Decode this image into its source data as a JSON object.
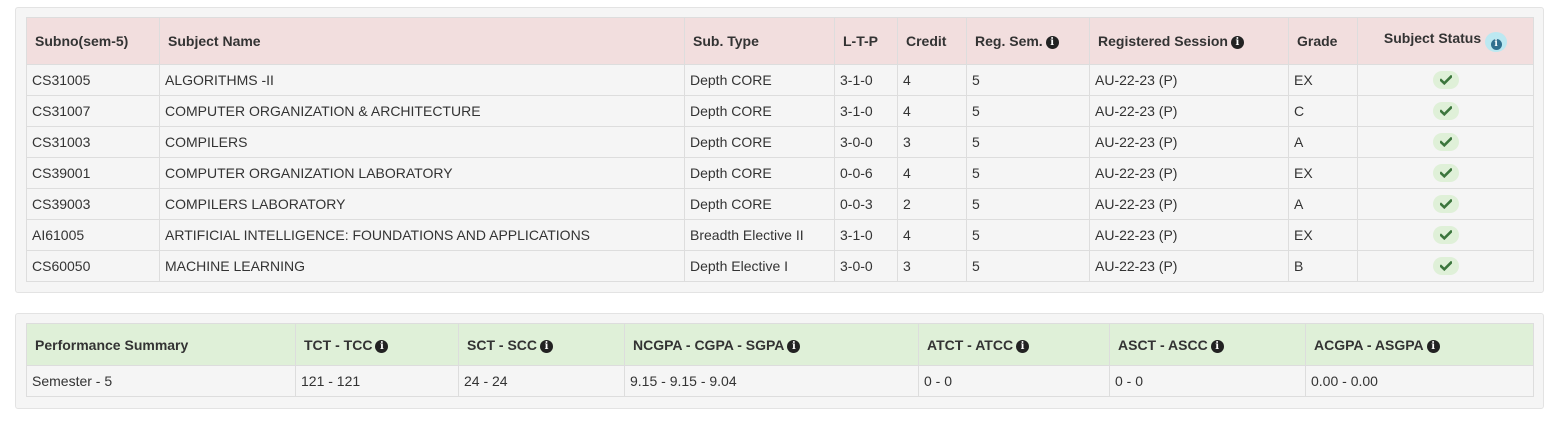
{
  "grades_table": {
    "headers": {
      "subno": "Subno(sem-5)",
      "subject_name": "Subject Name",
      "sub_type": "Sub. Type",
      "ltp": "L-T-P",
      "credit": "Credit",
      "reg_sem": "Reg. Sem.",
      "registered_session": "Registered Session",
      "grade": "Grade",
      "subject_status": "Subject Status"
    },
    "rows": [
      {
        "subno": "CS31005",
        "name": "ALGORITHMS -II",
        "type": "Depth CORE",
        "ltp": "3-1-0",
        "credit": "4",
        "reg_sem": "5",
        "session": "AU-22-23 (P)",
        "grade": "EX"
      },
      {
        "subno": "CS31007",
        "name": "COMPUTER ORGANIZATION & ARCHITECTURE",
        "type": "Depth CORE",
        "ltp": "3-1-0",
        "credit": "4",
        "reg_sem": "5",
        "session": "AU-22-23 (P)",
        "grade": "C"
      },
      {
        "subno": "CS31003",
        "name": "COMPILERS",
        "type": "Depth CORE",
        "ltp": "3-0-0",
        "credit": "3",
        "reg_sem": "5",
        "session": "AU-22-23 (P)",
        "grade": "A"
      },
      {
        "subno": "CS39001",
        "name": "COMPUTER ORGANIZATION LABORATORY",
        "type": "Depth CORE",
        "ltp": "0-0-6",
        "credit": "4",
        "reg_sem": "5",
        "session": "AU-22-23 (P)",
        "grade": "EX"
      },
      {
        "subno": "CS39003",
        "name": "COMPILERS LABORATORY",
        "type": "Depth CORE",
        "ltp": "0-0-3",
        "credit": "2",
        "reg_sem": "5",
        "session": "AU-22-23 (P)",
        "grade": "A"
      },
      {
        "subno": "AI61005",
        "name": "ARTIFICIAL INTELLIGENCE: FOUNDATIONS AND APPLICATIONS",
        "type": "Breadth Elective II",
        "ltp": "3-1-0",
        "credit": "4",
        "reg_sem": "5",
        "session": "AU-22-23 (P)",
        "grade": "EX"
      },
      {
        "subno": "CS60050",
        "name": "MACHINE LEARNING",
        "type": "Depth Elective I",
        "ltp": "3-0-0",
        "credit": "3",
        "reg_sem": "5",
        "session": "AU-22-23 (P)",
        "grade": "B"
      }
    ],
    "status_icon": "check-icon"
  },
  "summary_table": {
    "headers": {
      "performance": "Performance Summary",
      "tct_tcc": "TCT - TCC",
      "sct_scc": "SCT - SCC",
      "ncgpa": "NCGPA - CGPA - SGPA",
      "atct": "ATCT - ATCC",
      "asct": "ASCT - ASCC",
      "acgpa": "ACGPA - ASGPA"
    },
    "row": {
      "performance": "Semester - 5",
      "tct_tcc": "121 - 121",
      "sct_scc": "24 - 24",
      "ncgpa": "9.15 - 9.15 - 9.04",
      "atct": "0 - 0",
      "asct": "0 - 0",
      "acgpa": "0.00 - 0.00"
    }
  },
  "colors": {
    "grades_header_bg": "#f2dede",
    "summary_header_bg": "#dff0d8",
    "check_color": "#3c763d",
    "info_blue": "#bce8f1"
  }
}
